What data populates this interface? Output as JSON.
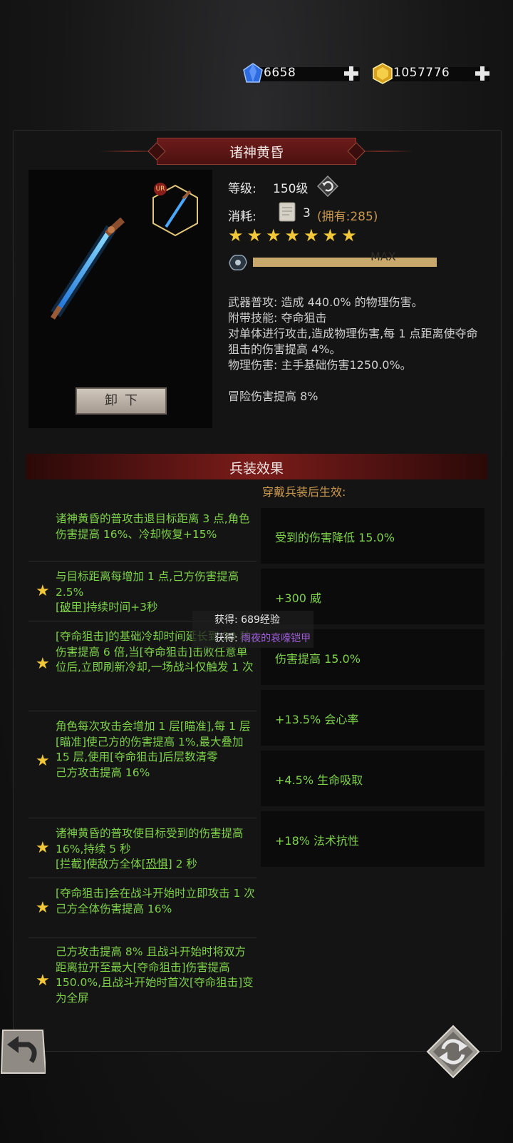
{
  "currency": {
    "gems": "6658",
    "gold": "1057776",
    "gem_color": "#2a66d9",
    "gold_color": "#e0b026"
  },
  "weapon": {
    "title": "诸神黄昏",
    "rarity_badge": "UR",
    "level_label": "等级:",
    "level_value": "150级",
    "cost_label": "消耗:",
    "cost_value": "3",
    "owned_text": "(拥有:285)",
    "stars": 7,
    "progress_text": "MAX",
    "progress_fraction": 1.0,
    "unload_label": "卸下",
    "description": [
      "武器普攻: 造成 440.0% 的物理伤害。",
      "附带技能: 夺命狙击",
      "对单体进行攻击,造成物理伤害,每 1 点距离使夺命狙击的伤害提高 4%。",
      "物理伤害: 主手基础伤害1250.0%。"
    ],
    "extra_bonus": "冒险伤害提高 8%"
  },
  "effects": {
    "title": "兵装效果",
    "wear_note": "穿戴兵装后生效:",
    "left_rows": [
      {
        "starred": false,
        "text": "诸神黄昏的普攻击退目标距离 3 点,角色伤害提高 16%、冷却恢复+15%"
      },
      {
        "starred": true,
        "text": "与目标距离每增加 1 点,己方伤害提高 2.5%",
        "text2_pre": "[",
        "text2_link": "破甲",
        "text2_post": "]持续时间+3秒"
      },
      {
        "starred": true,
        "text": "[夺命狙击]的基础冷却时间延长到 30 秒,伤害提高 6 倍,当[夺命狙击]击败任意单位后,立即刷新冷却,一场战斗仅触发 1 次"
      },
      {
        "starred": true,
        "text": "角色每次攻击会增加 1 层[瞄准],每 1 层[瞄准]使己方的伤害提高 1%,最大叠加 15 层,使用[夺命狙击]后层数清零",
        "text2": "己方攻击提高 16%"
      },
      {
        "starred": true,
        "text": "诸神黄昏的普攻使目标受到的伤害提高 16%,持续 5 秒",
        "text2_pre": "[拦截]使敌方全体[",
        "text2_link": "恐惧",
        "text2_post": "] 2 秒"
      },
      {
        "starred": true,
        "text": "[夺命狙击]会在战斗开始时立即攻击 1 次",
        "text2": "己方全体伤害提高 16%"
      },
      {
        "starred": true,
        "text": "己方攻击提高 8% 且战斗开始时将双方距离拉开至最大[夺命狙击]伤害提高 150.0%,且战斗开始时首次[夺命狙击]变为全屏"
      }
    ],
    "right_cards": [
      "受到的伤害降低 15.0%",
      "+300 威",
      "伤害提高 15.0%",
      "+13.5% 会心率",
      "+4.5% 生命吸取",
      "+18% 法术抗性"
    ]
  },
  "notification": {
    "line1": "获得: 689经验",
    "line2_prefix": "获得:",
    "line2_item": "雨夜的哀嚎铠甲"
  },
  "icons": [
    "gem-icon",
    "gold-icon",
    "plus-icon",
    "reset-icon",
    "scroll-icon",
    "star-icon",
    "soul-icon",
    "back-icon",
    "refresh-icon"
  ]
}
